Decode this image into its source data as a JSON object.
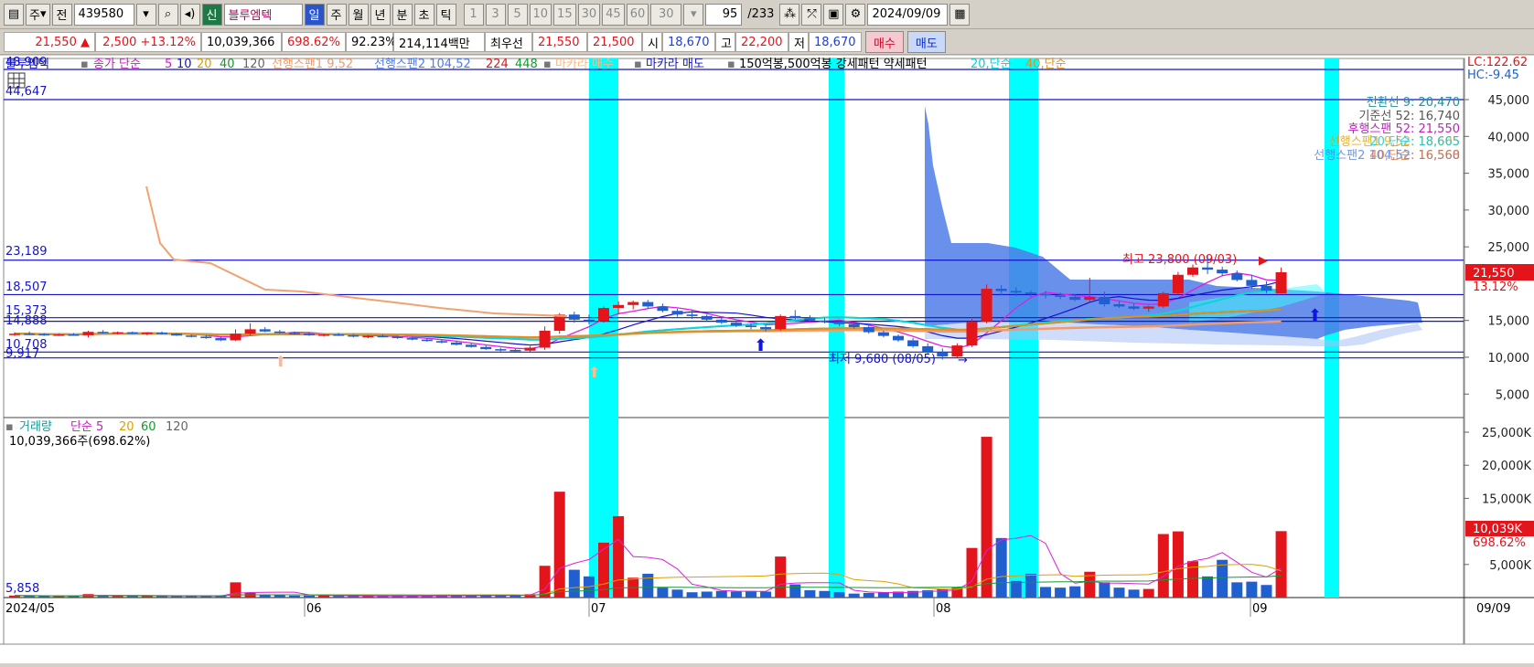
{
  "toolbar": {
    "period_week": "주",
    "prev_label": "전",
    "code": "439580",
    "new_badge": "신",
    "stock_name": "블루엠텍",
    "periods": [
      "일",
      "주",
      "월",
      "년",
      "분",
      "초",
      "틱"
    ],
    "active_period": "일",
    "minute_options": [
      "1",
      "3",
      "5",
      "10",
      "15",
      "30",
      "45",
      "60"
    ],
    "select_value": "30",
    "count_value": "95",
    "count_total": "/233",
    "date_value": "2024/09/09"
  },
  "quote": {
    "price": "21,550",
    "change": "2,500",
    "change_pct": "+13.12%",
    "volume": "10,039,366",
    "volume_ratio": "698.62%",
    "turnover_pct": "92.23%",
    "amount": "214,114백만",
    "best_bid_label": "최우선",
    "best_ask": "21,550",
    "best_bid": "21,500",
    "open_label": "시",
    "open": "18,670",
    "high_label": "고",
    "high": "22,200",
    "low_label": "저",
    "low": "18,670",
    "buy_button": "매수",
    "sell_button": "매도"
  },
  "legend": {
    "stock": "블루엠텍",
    "close_label": "종가 단순",
    "ma": [
      "5",
      "10",
      "20",
      "40",
      "120"
    ],
    "span1": "선행스팬1 9,52",
    "span2": "선행스팬2 104,52",
    "n224": "224",
    "n448": "448",
    "makara_buy": "마카라 매수",
    "makara_sell": "마카라 매도",
    "rest": "150억봉,500억봉 강세패턴 약세패턴",
    "s20": "20,단순",
    "s40": "40,단순"
  },
  "left_labels": {
    "top1": "48,909",
    "top2": "44,647",
    "l23189": "23,189",
    "l18507": "18,507",
    "l15373": "15,373",
    "l14888": "14,888",
    "l10708": "10,708",
    "l9917": "9,917",
    "vol_min": "5,858"
  },
  "right_axis": {
    "lc": "LC:122.62",
    "hc": "HC:-9.45",
    "price_ticks": [
      "45,000",
      "40,000",
      "35,000",
      "30,000",
      "25,000",
      "15,000",
      "10,000",
      "5,000"
    ],
    "price_now": "21,550",
    "price_pct": "13.12%",
    "vol_ticks": [
      "25,000K",
      "20,000K",
      "15,000K",
      "5,000K"
    ],
    "vol_now": "10,039K",
    "vol_pct": "698.62%"
  },
  "ichimoku": {
    "conversion": "전환선 9: 20,470",
    "base": "기준선 52: 16,740",
    "lagging": "후행스팬 52: 21,550",
    "leading1": "선행스팬1 9,52: 18,605",
    "leading2": "선행스팬2 104,52: 16,560",
    "s20": "20,단순: 18,665",
    "s40": "40,단순: 16,568"
  },
  "annotations": {
    "high": "최고 23,800 (09/03)",
    "low": "최저 9,680 (08/05)"
  },
  "volume_legend": {
    "label": "거래량",
    "ma_label": "단순 5",
    "ma": [
      "20",
      "60",
      "120"
    ],
    "current": "10,039,366주(698.62%)"
  },
  "x_axis": [
    "2024/05",
    "06",
    "07",
    "08",
    "09"
  ],
  "x_axis_right": "09/09",
  "colors": {
    "up": "#e3141a",
    "down": "#1f5fd0",
    "cyan_band": "#00ffff",
    "cloud": "#4f7ce6",
    "hline": "#1414c8"
  },
  "chart_data": {
    "type": "candlestick",
    "ylim": [
      0,
      48909
    ],
    "volume_ylim": [
      0,
      26000000
    ],
    "horizontal_lines": [
      48909,
      44647,
      23189,
      18507,
      15373,
      14888,
      10708,
      9917
    ],
    "candles": [
      [
        13100,
        13400,
        12900,
        13200,
        300000
      ],
      [
        13200,
        13500,
        13000,
        13150,
        280000
      ],
      [
        13150,
        13300,
        12900,
        13050,
        250000
      ],
      [
        13050,
        13200,
        12900,
        13100,
        220000
      ],
      [
        13100,
        13300,
        12950,
        13000,
        240000
      ],
      [
        13000,
        13600,
        12700,
        13450,
        520000
      ],
      [
        13450,
        13700,
        13200,
        13300,
        300000
      ],
      [
        13300,
        13500,
        13100,
        13400,
        280000
      ],
      [
        13400,
        13500,
        13150,
        13200,
        260000
      ],
      [
        13200,
        13400,
        13000,
        13350,
        250000
      ],
      [
        13350,
        13500,
        13100,
        13200,
        230000
      ],
      [
        13200,
        13300,
        12900,
        12950,
        220000
      ],
      [
        12950,
        13100,
        12700,
        12800,
        230000
      ],
      [
        12800,
        13000,
        12500,
        12600,
        260000
      ],
      [
        12600,
        12800,
        12200,
        12300,
        300000
      ],
      [
        12300,
        13800,
        12200,
        13200,
        2300000
      ],
      [
        13200,
        14600,
        13000,
        13800,
        700000
      ],
      [
        13800,
        14100,
        13400,
        13500,
        400000
      ],
      [
        13500,
        13700,
        13200,
        13300,
        350000
      ],
      [
        13300,
        13500,
        13050,
        13200,
        300000
      ],
      [
        13200,
        13400,
        12900,
        13000,
        300000
      ],
      [
        13000,
        13200,
        12800,
        13100,
        280000
      ],
      [
        13100,
        13300,
        12900,
        13000,
        260000
      ],
      [
        13000,
        13150,
        12700,
        12800,
        250000
      ],
      [
        12800,
        13000,
        12600,
        12900,
        240000
      ],
      [
        12900,
        13100,
        12700,
        12800,
        230000
      ],
      [
        12800,
        12950,
        12500,
        12600,
        240000
      ],
      [
        12600,
        12800,
        12300,
        12400,
        260000
      ],
      [
        12400,
        12600,
        12100,
        12200,
        270000
      ],
      [
        12200,
        12400,
        11900,
        12000,
        280000
      ],
      [
        12000,
        12200,
        11600,
        11700,
        300000
      ],
      [
        11700,
        11900,
        11300,
        11400,
        320000
      ],
      [
        11400,
        11600,
        11000,
        11100,
        330000
      ],
      [
        11100,
        11300,
        10800,
        11000,
        350000
      ],
      [
        11000,
        11200,
        10700,
        10900,
        370000
      ],
      [
        10900,
        11500,
        10600,
        11300,
        500000
      ],
      [
        11300,
        14200,
        11000,
        13600,
        4800000
      ],
      [
        13600,
        16000,
        13200,
        15800,
        16000000
      ],
      [
        15800,
        16200,
        14700,
        15100,
        4200000
      ],
      [
        15100,
        15800,
        14500,
        14900,
        3200000
      ],
      [
        14900,
        16900,
        14700,
        16700,
        8300000
      ],
      [
        16700,
        17600,
        15800,
        17100,
        12300000
      ],
      [
        17100,
        17700,
        16500,
        17500,
        3000000
      ],
      [
        17500,
        17800,
        16600,
        16900,
        3600000
      ],
      [
        16900,
        17300,
        16100,
        16300,
        1500000
      ],
      [
        16300,
        16600,
        15500,
        15800,
        1200000
      ],
      [
        15800,
        16400,
        15200,
        15600,
        800000
      ],
      [
        15600,
        15800,
        14900,
        15100,
        900000
      ],
      [
        15100,
        15500,
        14500,
        14700,
        1000000
      ],
      [
        14700,
        15000,
        14100,
        14300,
        900000
      ],
      [
        14300,
        14600,
        13800,
        14100,
        1000000
      ],
      [
        14100,
        14400,
        13500,
        13800,
        900000
      ],
      [
        13800,
        15800,
        13600,
        15600,
        6200000
      ],
      [
        15600,
        16400,
        15100,
        15300,
        2000000
      ],
      [
        15300,
        15700,
        14800,
        15000,
        1100000
      ],
      [
        15000,
        15400,
        14600,
        14800,
        1000000
      ],
      [
        14800,
        15100,
        14200,
        14500,
        800000
      ],
      [
        14500,
        14900,
        13900,
        14100,
        600000
      ],
      [
        14100,
        14300,
        13200,
        13400,
        700000
      ],
      [
        13400,
        13600,
        12700,
        12900,
        800000
      ],
      [
        12900,
        13100,
        12100,
        12300,
        900000
      ],
      [
        12300,
        12600,
        11300,
        11500,
        1000000
      ],
      [
        11500,
        11900,
        10500,
        10700,
        1100000
      ],
      [
        10700,
        11200,
        9680,
        10100,
        1300000
      ],
      [
        10100,
        11900,
        10000,
        11600,
        1500000
      ],
      [
        11600,
        15200,
        11400,
        14800,
        7500000
      ],
      [
        14800,
        19900,
        14600,
        19300,
        24300000
      ],
      [
        19300,
        19800,
        18400,
        19000,
        9000000
      ],
      [
        19000,
        19500,
        18300,
        18800,
        2500000
      ],
      [
        18800,
        19100,
        18200,
        18600,
        3600000
      ],
      [
        18600,
        19000,
        18000,
        18400,
        1600000
      ],
      [
        18400,
        18800,
        17900,
        18200,
        1500000
      ],
      [
        18200,
        18600,
        17600,
        17800,
        1700000
      ],
      [
        17800,
        20800,
        17600,
        18200,
        3900000
      ],
      [
        18200,
        18900,
        16900,
        17200,
        2300000
      ],
      [
        17200,
        17600,
        16700,
        16900,
        1500000
      ],
      [
        16900,
        17300,
        16400,
        16600,
        1200000
      ],
      [
        16600,
        17000,
        16200,
        16900,
        1300000
      ],
      [
        16900,
        18900,
        16700,
        18700,
        9600000
      ],
      [
        18700,
        21600,
        18500,
        21200,
        10000000
      ],
      [
        21200,
        22600,
        20900,
        22200,
        5500000
      ],
      [
        22200,
        23800,
        21300,
        21900,
        3200000
      ],
      [
        21900,
        22300,
        21000,
        21400,
        5700000
      ],
      [
        21400,
        21800,
        20300,
        20500,
        2300000
      ],
      [
        20500,
        21200,
        19300,
        19700,
        2400000
      ],
      [
        19700,
        20300,
        18700,
        19050,
        1900000
      ],
      [
        18670,
        22200,
        18670,
        21550,
        10039366
      ]
    ]
  }
}
